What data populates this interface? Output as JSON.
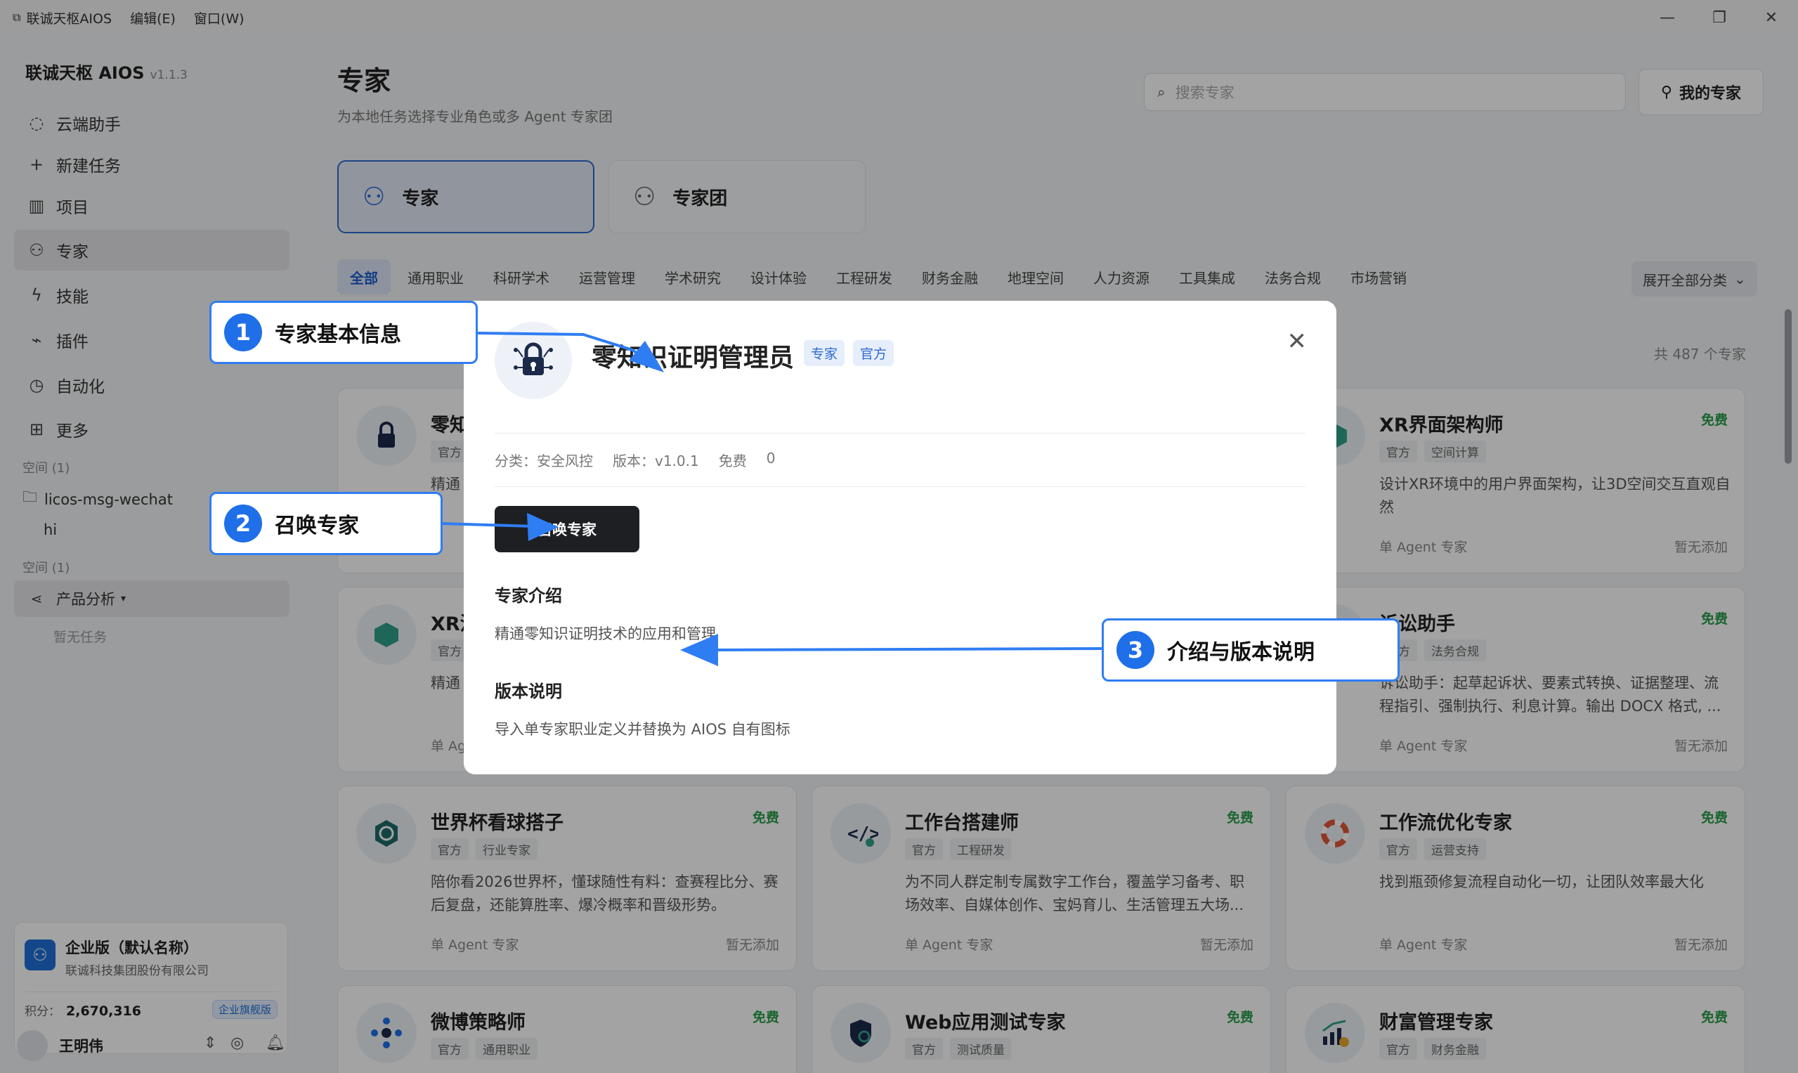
{
  "titlebar": {
    "app_name": "联诚天枢AIOS",
    "menus": [
      "编辑(E)",
      "窗口(W)"
    ]
  },
  "sidebar": {
    "brand": "联诚天枢 AIOS",
    "version": "v1.1.3",
    "items": [
      {
        "label": "云端助手",
        "icon": "chat-bubble-icon"
      },
      {
        "label": "新建任务",
        "icon": "plus-icon"
      },
      {
        "label": "项目",
        "icon": "kanban-icon"
      },
      {
        "label": "专家",
        "icon": "expert-icon"
      },
      {
        "label": "技能",
        "icon": "lightning-icon"
      },
      {
        "label": "插件",
        "icon": "plug-icon"
      },
      {
        "label": "自动化",
        "icon": "clock-icon"
      },
      {
        "label": "更多",
        "icon": "grid-icon"
      }
    ],
    "space1_label": "空间 (1)",
    "folder_name": "licos-msg-wechat",
    "folder_child": "hi",
    "space2_label": "空间 (1)",
    "group_name": "产品分析",
    "empty_task": "暂无任务",
    "enterprise": {
      "name": "企业版（默认名称）",
      "org": "联诚科技集团股份有限公司",
      "points_label": "积分：",
      "points": "2,670,316",
      "badge": "企业旗舰版"
    },
    "user_name": "王明伟"
  },
  "header": {
    "title": "专家",
    "subtitle": "为本地任务选择专业角色或多 Agent 专家团",
    "search_placeholder": "搜索专家",
    "my_button": "我的专家"
  },
  "segments": {
    "expert": "专家",
    "team": "专家团"
  },
  "filters": [
    "全部",
    "通用职业",
    "科研学术",
    "运营管理",
    "学术研究",
    "设计体验",
    "工程研发",
    "财务金融",
    "地理空间",
    "人力资源",
    "工具集成",
    "法务合规",
    "市场营销"
  ],
  "expand_label": "展开全部分类",
  "count_label": "共 487 个专家",
  "cards": [
    {
      "title": "零知",
      "tags": [
        "官方"
      ],
      "desc": "精通",
      "foot_left": "",
      "foot_right": "",
      "free": ""
    },
    {
      "title": "XR界面架构师",
      "tags": [
        "官方",
        "空间计算"
      ],
      "desc": "设计XR环境中的用户界面架构，让3D空间交互直观自然",
      "foot_left": "单 Agent 专家",
      "foot_right": "暂无添加",
      "free": "免费"
    },
    {
      "title": "XR沉",
      "tags": [
        "官方"
      ],
      "desc": "精通",
      "foot_left": "单 Ag",
      "foot_right": "",
      "free": ""
    },
    {
      "title": "诉讼助手",
      "tags": [
        "官方",
        "法务合规"
      ],
      "desc": "诉讼助手：起草起诉状、要素式转换、证据整理、流程指引、强制执行、利息计算。输出 DOCX 格式, ...",
      "foot_left": "单 Agent 专家",
      "foot_right": "暂无添加",
      "free": "免费"
    },
    {
      "title": "世界杯看球搭子",
      "tags": [
        "官方",
        "行业专家"
      ],
      "desc": "陪你看2026世界杯，懂球随性有料：查赛程比分、赛后复盘，还能算胜率、爆冷概率和晋级形势。",
      "foot_left": "单 Agent 专家",
      "foot_right": "暂无添加",
      "free": "免费"
    },
    {
      "title": "工作台搭建师",
      "tags": [
        "官方",
        "工程研发"
      ],
      "desc": "为不同人群定制专属数字工作台，覆盖学习备考、职场效率、自媒体创作、宝妈育儿、生活管理五大场...",
      "foot_left": "单 Agent 专家",
      "foot_right": "暂无添加",
      "free": "免费"
    },
    {
      "title": "工作流优化专家",
      "tags": [
        "官方",
        "运营支持"
      ],
      "desc": "找到瓶颈修复流程自动化一切，让团队效率最大化",
      "foot_left": "单 Agent 专家",
      "foot_right": "暂无添加",
      "free": "免费"
    },
    {
      "title": "微博策略师",
      "tags": [
        "官方",
        "通用职业"
      ],
      "desc": "",
      "foot_left": "",
      "foot_right": "",
      "free": "免费"
    },
    {
      "title": "Web应用测试专家",
      "tags": [
        "官方",
        "测试质量"
      ],
      "desc": "",
      "foot_left": "",
      "foot_right": "",
      "free": "免费"
    },
    {
      "title": "财富管理专家",
      "tags": [
        "官方",
        "财务金融"
      ],
      "desc": "",
      "foot_left": "",
      "foot_right": "",
      "free": "免费"
    }
  ],
  "modal": {
    "title": "零知识证明管理员",
    "tag_type": "专家",
    "tag_official": "官方",
    "category": "分类：安全风控",
    "version": "版本：v1.0.1",
    "price": "免费",
    "count": "0",
    "summon_button": "召唤专家",
    "intro_heading": "专家介绍",
    "intro_text": "精通零知识证明技术的应用和管理",
    "version_heading": "版本说明",
    "version_text": "导入单专家职业定义并替换为 AIOS 自有图标"
  },
  "callouts": [
    {
      "num": "1",
      "label": "专家基本信息"
    },
    {
      "num": "2",
      "label": "召唤专家"
    },
    {
      "num": "3",
      "label": "介绍与版本说明"
    }
  ],
  "colors": {
    "accent": "#2e6ad1",
    "free": "#2a9d4a",
    "callout": "#1f6fe8"
  }
}
